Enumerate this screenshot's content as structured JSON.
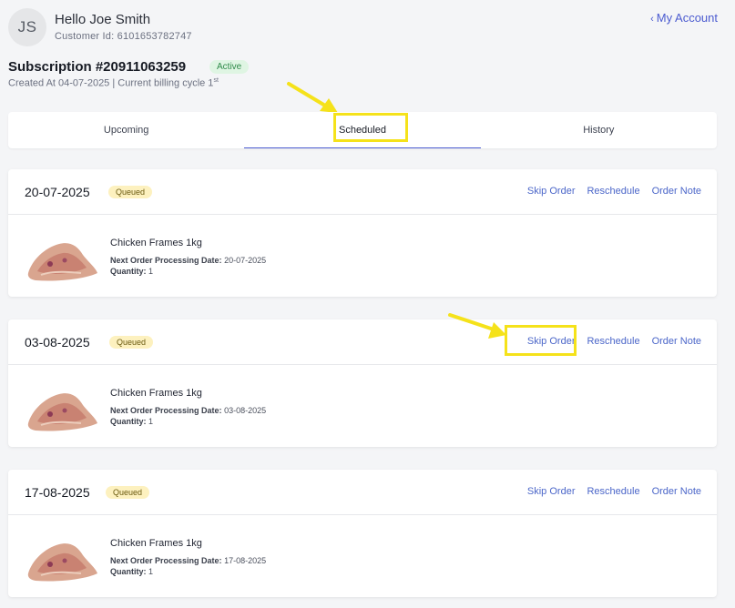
{
  "header": {
    "avatar_initials": "JS",
    "greeting": "Hello Joe Smith",
    "customer_id": "Customer Id: 6101653782747",
    "my_account_label": "My Account"
  },
  "subscription": {
    "title": "Subscription #20911063259",
    "status": "Active",
    "created_text": "Created At 04-07-2025 | Current billing cycle 1",
    "cycle_suffix": "st"
  },
  "tabs": [
    {
      "label": "Upcoming"
    },
    {
      "label": "Scheduled"
    },
    {
      "label": "History"
    }
  ],
  "orders": [
    {
      "date": "20-07-2025",
      "status": "Queued",
      "actions": {
        "skip": "Skip Order",
        "reschedule": "Reschedule",
        "note": "Order Note"
      },
      "product": "Chicken Frames 1kg",
      "processing_label": "Next Order Processing Date:",
      "processing_date": "20-07-2025",
      "quantity_label": "Quantity:",
      "quantity": "1"
    },
    {
      "date": "03-08-2025",
      "status": "Queued",
      "actions": {
        "skip": "Skip Order",
        "reschedule": "Reschedule",
        "note": "Order Note"
      },
      "product": "Chicken Frames 1kg",
      "processing_label": "Next Order Processing Date:",
      "processing_date": "03-08-2025",
      "quantity_label": "Quantity:",
      "quantity": "1"
    },
    {
      "date": "17-08-2025",
      "status": "Queued",
      "actions": {
        "skip": "Skip Order",
        "reschedule": "Reschedule",
        "note": "Order Note"
      },
      "product": "Chicken Frames 1kg",
      "processing_label": "Next Order Processing Date:",
      "processing_date": "17-08-2025",
      "quantity_label": "Quantity:",
      "quantity": "1"
    }
  ],
  "colors": {
    "accent": "#4b5bd0",
    "link": "#4b66c9",
    "highlight": "#f5e21a",
    "active_badge_bg": "#dff5e3",
    "queued_badge_bg": "#fdf1bf"
  }
}
